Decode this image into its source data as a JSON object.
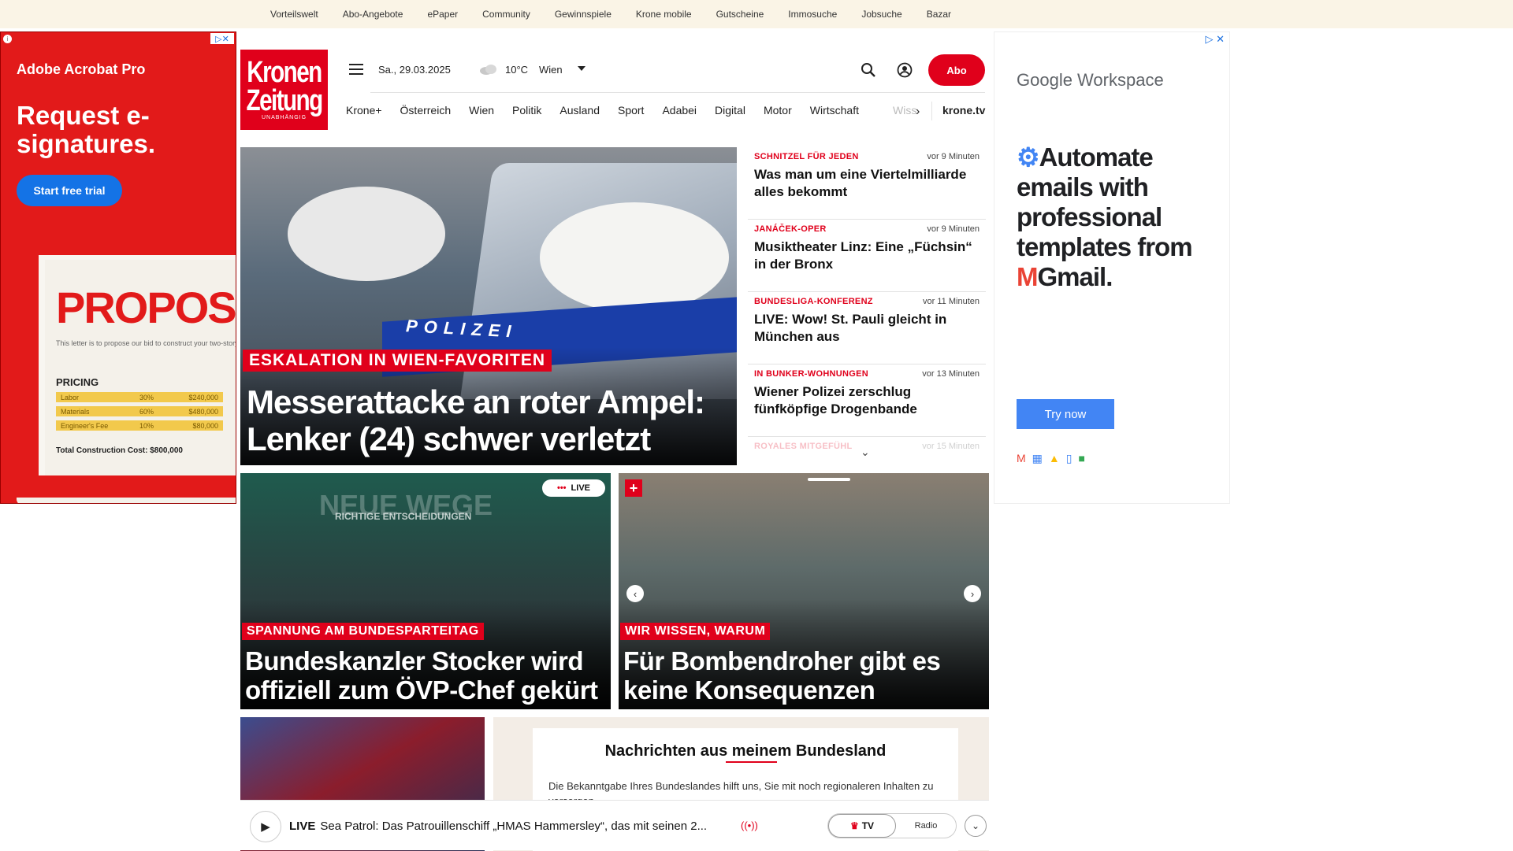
{
  "topnav": [
    "Vorteilswelt",
    "Abo-Angebote",
    "ePaper",
    "Community",
    "Gewinnspiele",
    "Krone mobile",
    "Gutscheine",
    "Immosuche",
    "Jobsuche",
    "Bazar"
  ],
  "ad_left": {
    "brand": "Adobe Acrobat Pro",
    "headline": "Request e-signatures.",
    "cta": "Start free trial",
    "doc_title": "PROPOSAL",
    "doc_text": "This letter is to propose our bid to construct your two-story residential property in Los Angeles, this October. See below for bid proposal.",
    "pricing_label": "PRICING",
    "rows": [
      {
        "item": "Labor",
        "pct": "30%",
        "amount": "$240,000"
      },
      {
        "item": "Materials",
        "pct": "60%",
        "amount": "$480,000"
      },
      {
        "item": "Engineer's Fee",
        "pct": "10%",
        "amount": "$80,000"
      }
    ],
    "total": "Total Construction Cost: $800,000"
  },
  "header": {
    "logo_line1": "Kronen",
    "logo_line2": "Zeitung",
    "logo_line3": "UNABHÄNGIG",
    "date": "Sa., 29.03.2025",
    "temperature": "10°C",
    "city": "Wien",
    "abo_label": "Abo"
  },
  "nav": {
    "items": [
      "Krone+",
      "Österreich",
      "Wien",
      "Politik",
      "Ausland",
      "Sport",
      "Adabei",
      "Digital",
      "Motor",
      "Wirtschaft"
    ],
    "faded": "Wiss",
    "krone_tv": "krone.tv"
  },
  "hero": {
    "kicker": "ESKALATION IN WIEN-FAVORITEN",
    "title": "Messerattacke an roter Ampel: Lenker (24) schwer verletzt",
    "polizei": "POLIZEI"
  },
  "news": [
    {
      "cat": "SCHNITZEL FÜR JEDEN",
      "time": "vor 9 Minuten",
      "title": "Was man um eine Viertelmilliarde alles bekommt"
    },
    {
      "cat": "JANÁČEK-OPER",
      "time": "vor 9 Minuten",
      "title": "Musiktheater Linz: Eine „Füchsin“ in der Bronx"
    },
    {
      "cat": "BUNDESLIGA-KONFERENZ",
      "time": "vor 11 Minuten",
      "title": "LIVE: Wow! St. Pauli gleicht in München aus"
    },
    {
      "cat": "IN BUNKER-WOHNUNGEN",
      "time": "vor 13 Minuten",
      "title": "Wiener Polizei zerschlug fünfköpfige Drogenbande"
    },
    {
      "cat": "ROYALES MITGEFÜHL",
      "time": "vor 15 Minuten",
      "title": ""
    }
  ],
  "card1": {
    "kicker": "SPANNUNG AM BUNDESPARTEITAG",
    "title": "Bundeskanzler Stocker wird offiziell zum ÖVP-Chef gekürt",
    "live": "LIVE",
    "bg_text1": "NEUE WEGE",
    "bg_text2": "RICHTIGE ENTSCHEIDUNGEN"
  },
  "card2": {
    "kicker": "WIR WISSEN, WARUM",
    "title": "Für Bombendroher gibt es keine Konsequenzen"
  },
  "region": {
    "title": "Nachrichten aus meinem Bundesland",
    "text": "Die Bekanntgabe Ihres Bundeslandes hilft uns, Sie mit noch regionaleren Inhalten zu versorgen."
  },
  "player": {
    "live": "LIVE",
    "text": "Sea Patrol: Das Patrouillenschiff „HMAS Hammersley“, das mit seinen 2...",
    "tv": "TV",
    "radio": "Radio"
  },
  "ad_right": {
    "brand": "Google Workspace",
    "headline_1": "Automate emails with professional templates from",
    "headline_2": "Gmail.",
    "cta": "Try now"
  },
  "colors": {
    "brand_red": "#e0001b",
    "topbar": "#faf4e6",
    "google_blue": "#4285f4"
  }
}
